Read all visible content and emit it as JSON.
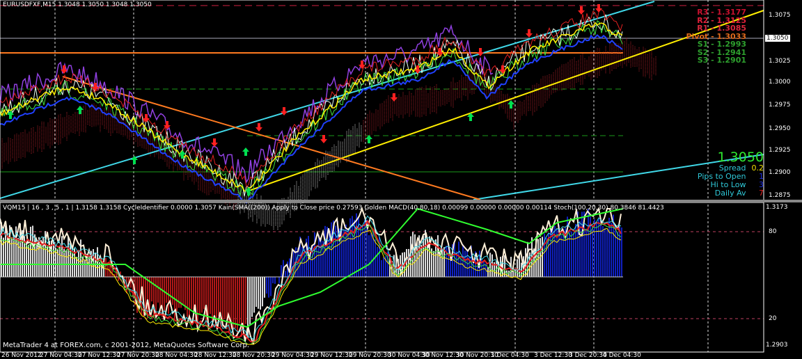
{
  "header": {
    "symbol_line": "EURUSDFXF,M15  1.3048 1.3050 1.3048 1.3050"
  },
  "pivots": [
    {
      "label": "R3 - 1.3177",
      "color": "#c8102e"
    },
    {
      "label": "R2 - 1.3125",
      "color": "#e0203a"
    },
    {
      "label": "R1 - 1.3085",
      "color": "#d8283c"
    },
    {
      "label": "Pivot - 1.3033",
      "color": "#e06a1c"
    },
    {
      "label": "S1 - 1.2993",
      "color": "#2ea12e"
    },
    {
      "label": "S2 - 1.2941",
      "color": "#2ea12e"
    },
    {
      "label": "S3 - 1.2901",
      "color": "#2ea12e"
    }
  ],
  "info_panel": {
    "price": "1.3050",
    "spread_label": "Spread",
    "spread_value": "0.2",
    "pips_label": "Pips to Open",
    "pips_value": "1",
    "hilo_label": "Hi to Low",
    "hilo_value": "3",
    "daily_label": "Daily Av",
    "daily_value": "7"
  },
  "price_axis": {
    "current": "1.3050",
    "ticks": [
      "1.3075",
      "1.3025",
      "1.3000",
      "1.2975",
      "1.2950",
      "1.2925",
      "1.2900",
      "1.2875"
    ]
  },
  "indicator": {
    "header": "VQM15 |  16 , 3 , 5 , 1  |  1.3158 1.3158  CycleIdentifier 0.0000 1.3057  Kain(SMA((200)) Apply to Close price 0.27593  Golden MACD(40,80,18) 0.00099 0.00000 0.00000 0.00114  Stoch(100,20,30) 80.3846 81.4423",
    "axis_top": "1.3173",
    "level_high": "80",
    "level_low": "20",
    "axis_bottom": "1.2903"
  },
  "footer": {
    "copyright": "MetaTrader 4 at FOREX.com, c 2001-2012, MetaQuotes Software Corp."
  },
  "time_axis": [
    "26 Nov 2012",
    "27 Nov 04:30",
    "27 Nov 12:30",
    "27 Nov 20:30",
    "28 Nov 04:30",
    "28 Nov 12:30",
    "28 Nov 20:30",
    "29 Nov 04:30",
    "29 Nov 12:30",
    "29 Nov 20:30",
    "30 Nov 04:30",
    "30 Nov 12:30",
    "30 Nov 20:30",
    "1 Dec 04:30",
    "3 Dec 12:30",
    "3 Dec 20:30",
    "4 Dec 04:30"
  ],
  "colors": {
    "background": "#000000",
    "bullish_arrow": "#00e050",
    "bearish_arrow": "#ff2020",
    "channel": "#40d8e8",
    "trend": "#ffee00"
  }
}
